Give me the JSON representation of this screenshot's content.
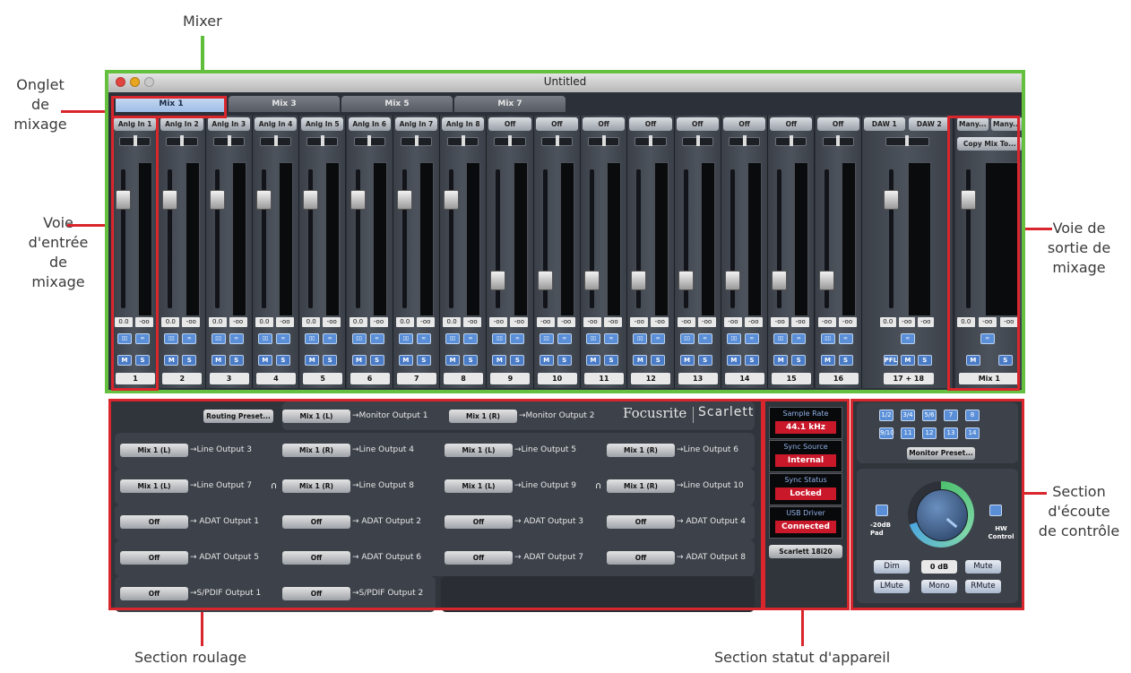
{
  "annotations": {
    "mixer": "Mixer",
    "tab_lines": [
      "Onglet",
      "de",
      "mixage"
    ],
    "input_lines": [
      "Voie",
      "d'entrée",
      "de",
      "mixage"
    ],
    "output_lines": [
      "Voie de",
      "sortie de",
      "mixage"
    ],
    "monitor_lines": [
      "Section",
      "d'écoute",
      "de contrôle"
    ],
    "routing": "Section roulage",
    "status": "Section statut d'appareil"
  },
  "window": {
    "title": "Untitled"
  },
  "tabs": [
    "Mix 1",
    "Mix 3",
    "Mix 5",
    "Mix 7"
  ],
  "channels": [
    {
      "source": "Anlg In 1",
      "number": "1",
      "vol": "0.0",
      "peak": "-oo",
      "level": 0.78
    },
    {
      "source": "Anlg In 2",
      "number": "2",
      "vol": "0.0",
      "peak": "-oo",
      "level": 0.78
    },
    {
      "source": "Anlg In 3",
      "number": "3",
      "vol": "0.0",
      "peak": "-oo",
      "level": 0.78
    },
    {
      "source": "Anlg In 4",
      "number": "4",
      "vol": "0.0",
      "peak": "-oo",
      "level": 0.78
    },
    {
      "source": "Anlg In 5",
      "number": "5",
      "vol": "0.0",
      "peak": "-oo",
      "level": 0.78
    },
    {
      "source": "Anlg In 6",
      "number": "6",
      "vol": "0.0",
      "peak": "-oo",
      "level": 0.78
    },
    {
      "source": "Anlg In 7",
      "number": "7",
      "vol": "0.0",
      "peak": "-oo",
      "level": 0.78
    },
    {
      "source": "Anlg In 8",
      "number": "8",
      "vol": "0.0",
      "peak": "-oo",
      "level": 0.78
    },
    {
      "source": "Off",
      "number": "9",
      "vol": "-oo",
      "peak": "-oo",
      "level": 0.2
    },
    {
      "source": "Off",
      "number": "10",
      "vol": "-oo",
      "peak": "-oo",
      "level": 0.2
    },
    {
      "source": "Off",
      "number": "11",
      "vol": "-oo",
      "peak": "-oo",
      "level": 0.2
    },
    {
      "source": "Off",
      "number": "12",
      "vol": "-oo",
      "peak": "-oo",
      "level": 0.2
    },
    {
      "source": "Off",
      "number": "13",
      "vol": "-oo",
      "peak": "-oo",
      "level": 0.2
    },
    {
      "source": "Off",
      "number": "14",
      "vol": "-oo",
      "peak": "-oo",
      "level": 0.2
    },
    {
      "source": "Off",
      "number": "15",
      "vol": "-oo",
      "peak": "-oo",
      "level": 0.2
    },
    {
      "source": "Off",
      "number": "16",
      "vol": "-oo",
      "peak": "-oo",
      "level": 0.2
    }
  ],
  "stereo_channel": {
    "sources": [
      "DAW 1",
      "DAW 2"
    ],
    "number": "17 + 18",
    "vol": "0.0",
    "peak": "-oo",
    "peak2": "-oo",
    "level": 0.78
  },
  "mix_output": {
    "sources": [
      "Many...",
      "Many..."
    ],
    "copy_label": "Copy Mix To...",
    "number": "Mix 1",
    "vol": "0.0",
    "peak": "-oo",
    "peak2": "-oo",
    "level": 0.78
  },
  "routing": {
    "preset_label": "Routing Preset...",
    "brand": "Focusrite",
    "model": "Scarlett",
    "monitor_row": [
      {
        "src": "Mix 1 (L)",
        "dest": "→Monitor Output 1"
      },
      {
        "src": "Mix 1 (R)",
        "dest": "→Monitor Output 2"
      }
    ],
    "line_row_1": [
      {
        "src": "Mix 1 (L)",
        "dest": "→Line Output 3"
      },
      {
        "src": "Mix 1 (R)",
        "dest": "→Line Output 4"
      },
      {
        "src": "Mix 1 (L)",
        "dest": "→Line Output 5"
      },
      {
        "src": "Mix 1 (R)",
        "dest": "→Line Output 6"
      }
    ],
    "line_row_2": [
      {
        "src": "Mix 1 (L)",
        "dest": "→Line Output 7"
      },
      {
        "src": "Mix 1 (R)",
        "dest": "→Line Output 8"
      },
      {
        "src": "Mix 1 (L)",
        "dest": "→Line Output 9"
      },
      {
        "src": "Mix 1 (R)",
        "dest": "→Line Output 10"
      }
    ],
    "adat_row_1": [
      {
        "src": "Off",
        "dest": "→ ADAT Output 1"
      },
      {
        "src": "Off",
        "dest": "→ ADAT Output 2"
      },
      {
        "src": "Off",
        "dest": "→ ADAT Output 3"
      },
      {
        "src": "Off",
        "dest": "→ ADAT Output 4"
      }
    ],
    "adat_row_2": [
      {
        "src": "Off",
        "dest": "→ ADAT Output 5"
      },
      {
        "src": "Off",
        "dest": "→ ADAT Output 6"
      },
      {
        "src": "Off",
        "dest": "→ ADAT Output 7"
      },
      {
        "src": "Off",
        "dest": "→ ADAT Output 8"
      }
    ],
    "spdif_row": [
      {
        "src": "Off",
        "dest": "→S/PDIF Output 1"
      },
      {
        "src": "Off",
        "dest": "→S/PDIF Output 2"
      }
    ],
    "headphone_icon": "headphones-icon"
  },
  "device_status": {
    "sample_rate_label": "Sample Rate",
    "sample_rate": "44.1 kHz",
    "sync_source_label": "Sync Source",
    "sync_source": "Internal",
    "sync_status_label": "Sync Status",
    "sync_status": "Locked",
    "usb_label": "USB Driver",
    "usb": "Connected",
    "device": "Scarlett 18i20"
  },
  "monitor": {
    "preset_label": "Monitor Preset...",
    "top_buttons": [
      "1/2",
      "3/4",
      "5/6",
      "7",
      "8"
    ],
    "bottom_buttons": [
      "9/10",
      "11",
      "12",
      "13",
      "14"
    ],
    "pad_label": "-20dB\nPad",
    "hw_label": "HW\nControl",
    "dim": "Dim",
    "level": "0 dB",
    "mute": "Mute",
    "lmute": "LMute",
    "mono": "Mono",
    "rmute": "RMute"
  },
  "colors": {
    "highlight_red": "#d9262c",
    "mixer_green": "#5fbd3c",
    "status_red": "#c8182a",
    "button_blue": "#5a8fd8"
  }
}
